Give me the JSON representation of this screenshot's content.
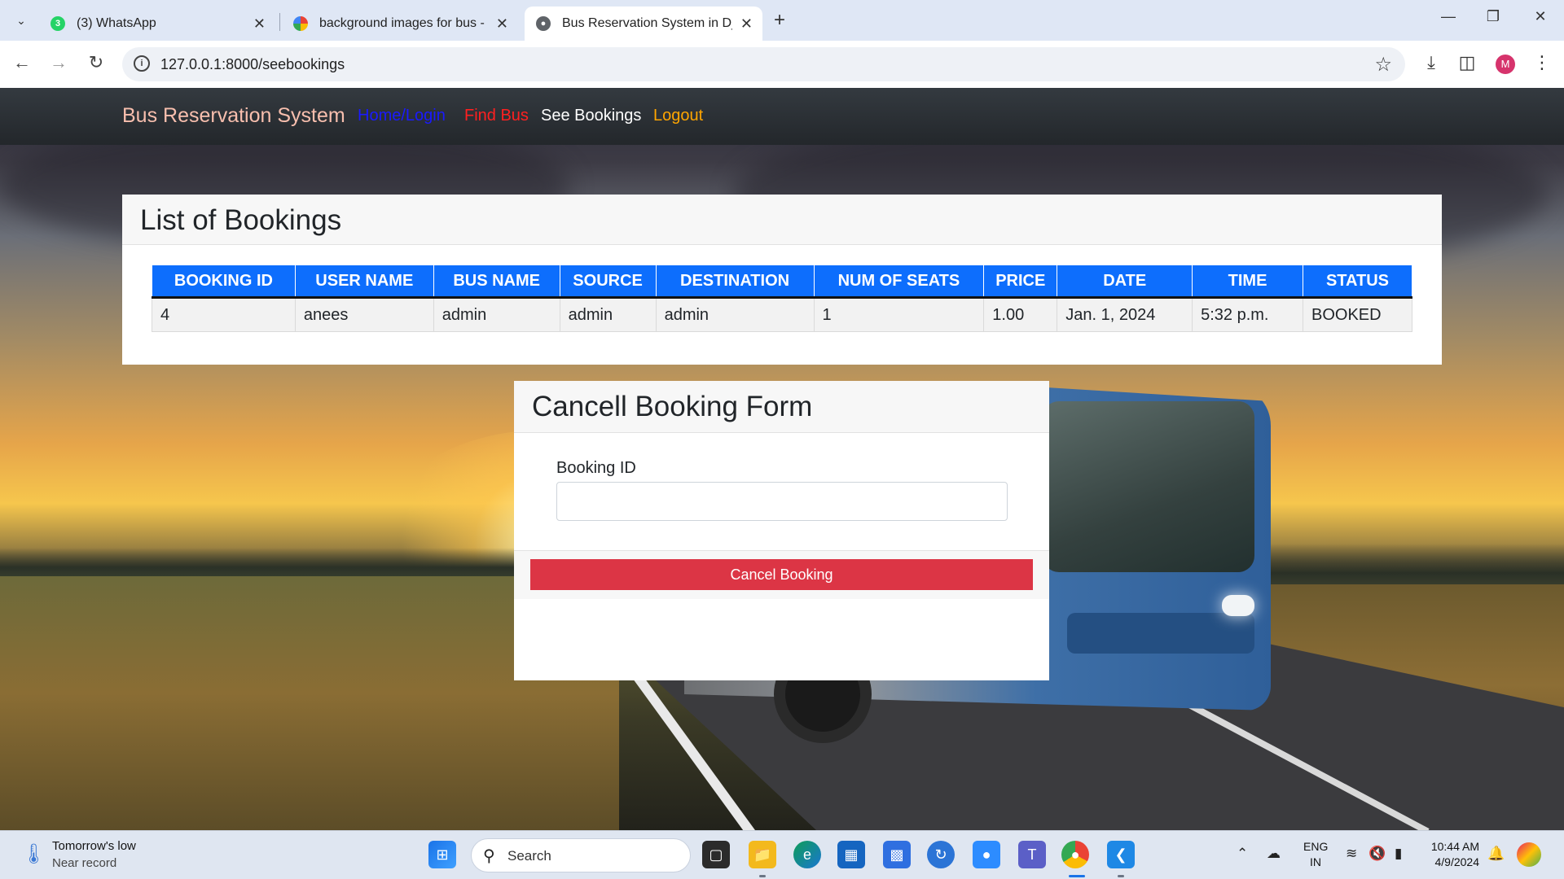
{
  "browser": {
    "tabs": [
      {
        "title": "(3) WhatsApp",
        "badge": "3"
      },
      {
        "title": "background images for bus - G"
      },
      {
        "title": "Bus Reservation System in Djan"
      }
    ],
    "url": "127.0.0.1:8000/seebookings",
    "profile_initial": "M"
  },
  "site": {
    "brand": "Bus Reservation System",
    "nav": [
      {
        "label": "Home/Login",
        "color": "#1a1aff"
      },
      {
        "label": "Find Bus",
        "color": "#ff2020"
      },
      {
        "label": "See Bookings",
        "color": "#ffffff"
      },
      {
        "label": "Logout",
        "color": "#ffa500"
      }
    ]
  },
  "bookings": {
    "title": "List of Bookings",
    "columns": [
      "BOOKING ID",
      "USER NAME",
      "BUS NAME",
      "SOURCE",
      "DESTINATION",
      "NUM OF SEATS",
      "PRICE",
      "DATE",
      "TIME",
      "STATUS"
    ],
    "rows": [
      [
        "4",
        "anees",
        "admin",
        "admin",
        "admin",
        "1",
        "1.00",
        "Jan. 1, 2024",
        "5:32 p.m.",
        "BOOKED"
      ]
    ]
  },
  "cancel_form": {
    "title": "Cancell Booking Form",
    "field_label": "Booking ID",
    "field_value": "",
    "button_label": "Cancel Booking"
  },
  "taskbar": {
    "weather_line1": "Tomorrow's low",
    "weather_line2": "Near record",
    "search_label": "Search",
    "lang_line1": "ENG",
    "lang_line2": "IN",
    "time": "10:44 AM",
    "date": "4/9/2024"
  },
  "colors": {
    "primary": "#0d6efd",
    "danger": "#dc3545",
    "navbar": "#2b3035"
  }
}
